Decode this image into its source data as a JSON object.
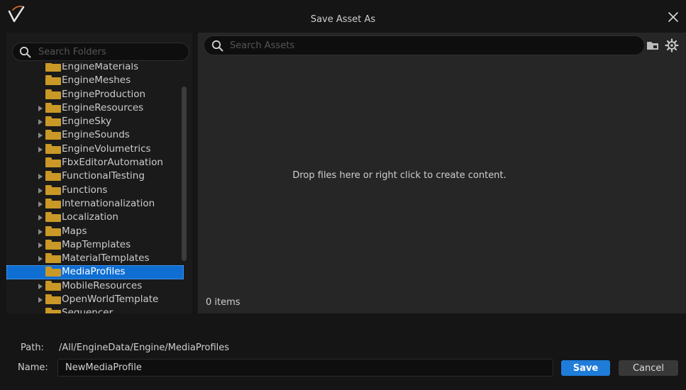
{
  "window": {
    "title": "Save Asset As",
    "logo_icon": "unreal-logo-icon",
    "close_icon": "close-icon"
  },
  "folder_search": {
    "placeholder": "Search Folders",
    "icon": "search-icon"
  },
  "folder_tree": {
    "folder_color": "#c99827",
    "selected_color": "#0e6ed2",
    "items": [
      {
        "label": "EngineMaterials",
        "has_children": false,
        "selected": false
      },
      {
        "label": "EngineMeshes",
        "has_children": false,
        "selected": false
      },
      {
        "label": "EngineProduction",
        "has_children": false,
        "selected": false
      },
      {
        "label": "EngineResources",
        "has_children": true,
        "selected": false
      },
      {
        "label": "EngineSky",
        "has_children": true,
        "selected": false
      },
      {
        "label": "EngineSounds",
        "has_children": true,
        "selected": false
      },
      {
        "label": "EngineVolumetrics",
        "has_children": true,
        "selected": false
      },
      {
        "label": "FbxEditorAutomation",
        "has_children": false,
        "selected": false
      },
      {
        "label": "FunctionalTesting",
        "has_children": true,
        "selected": false
      },
      {
        "label": "Functions",
        "has_children": true,
        "selected": false
      },
      {
        "label": "Internationalization",
        "has_children": true,
        "selected": false
      },
      {
        "label": "Localization",
        "has_children": true,
        "selected": false
      },
      {
        "label": "Maps",
        "has_children": true,
        "selected": false
      },
      {
        "label": "MapTemplates",
        "has_children": true,
        "selected": false
      },
      {
        "label": "MaterialTemplates",
        "has_children": true,
        "selected": false
      },
      {
        "label": "MediaProfiles",
        "has_children": false,
        "selected": true
      },
      {
        "label": "MobileResources",
        "has_children": true,
        "selected": false
      },
      {
        "label": "OpenWorldTemplate",
        "has_children": true,
        "selected": false
      },
      {
        "label": "Sequencer",
        "has_children": false,
        "selected": false
      }
    ]
  },
  "asset_search": {
    "placeholder": "Search Assets",
    "icon": "search-icon",
    "folder_button_icon": "folder-icon",
    "settings_button_icon": "gear-icon"
  },
  "content": {
    "empty_hint": "Drop files here or right click to create content.",
    "item_count": "0 items"
  },
  "footer": {
    "path_label": "Path:",
    "path_value": "/All/EngineData/Engine/MediaProfiles",
    "name_label": "Name:",
    "name_value": "NewMediaProfile",
    "save_label": "Save",
    "cancel_label": "Cancel",
    "save_color": "#1f7cd9"
  }
}
